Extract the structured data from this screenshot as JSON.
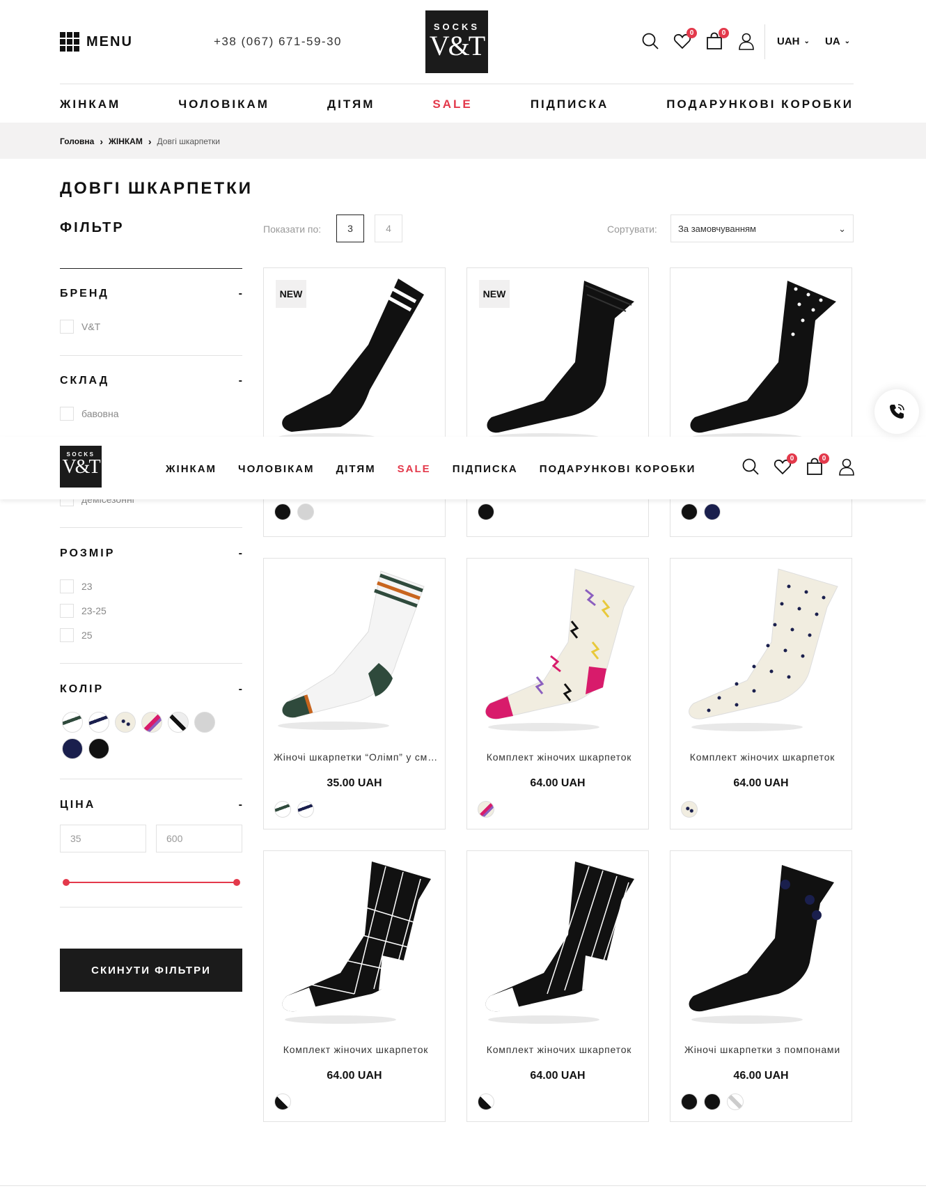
{
  "header": {
    "menu_label": "MENU",
    "phone": "+38 (067) 671-59-30",
    "logo_top": "SOCKS",
    "logo_main": "V&T",
    "wishlist_count": "0",
    "cart_count": "0",
    "currency": "UAH",
    "language": "UA"
  },
  "nav": [
    "ЖІНКАМ",
    "ЧОЛОВІКАМ",
    "ДІТЯМ",
    "SALE",
    "ПІДПИСКА",
    "ПОДАРУНКОВІ КОРОБКИ"
  ],
  "breadcrumb": [
    "Головна",
    "ЖІНКАМ",
    "Довгі шкарпетки"
  ],
  "page_title": "ДОВГІ ШКАРПЕТКИ",
  "filter": {
    "title": "ФІЛЬТР",
    "toggle": "-",
    "brand": {
      "title": "БРЕНД",
      "options": [
        "V&T"
      ]
    },
    "composition": {
      "title": "СКЛАД",
      "options": [
        "бавовна"
      ]
    },
    "season_option": "демісезонні",
    "size": {
      "title": "РОЗМІР",
      "options": [
        "23",
        "23-25",
        "25"
      ]
    },
    "color": {
      "title": "КОЛІР"
    },
    "price": {
      "title": "ЦІНА",
      "min": "35",
      "max": "600"
    },
    "reset_label": "СКИНУТИ ФІЛЬТРИ"
  },
  "toolbar": {
    "show_label": "Показати по:",
    "per_page": [
      "3",
      "4"
    ],
    "active_per_page": "3",
    "sort_label": "Сортувати:",
    "sort_value": "За замовчуванням"
  },
  "products_row1": [
    {
      "badge": "NEW"
    },
    {
      "badge": "NEW"
    },
    {
      "badge": ""
    }
  ],
  "products": [
    {
      "name": "Жіночі шкарпетки “Олімп” у смужку",
      "price": "35.00 UAH"
    },
    {
      "name": "Комплект жіночих шкарпеток",
      "price": "64.00 UAH"
    },
    {
      "name": "Комплект жіночих шкарпеток",
      "price": "64.00 UAH"
    },
    {
      "name": "Комплект жіночих шкарпеток",
      "price": "64.00 UAH"
    },
    {
      "name": "Комплект жіночих шкарпеток",
      "price": "64.00 UAH"
    },
    {
      "name": "Жіночі шкарпетки з помпонами",
      "price": "46.00 UAH"
    }
  ],
  "colors": {
    "accent": "#e3394b",
    "dark": "#1b1b1b",
    "navy": "#1a1f4d",
    "cream": "#f1ede0",
    "green": "#2f4a3c",
    "orange": "#c8651e",
    "magenta": "#d81b6b"
  }
}
